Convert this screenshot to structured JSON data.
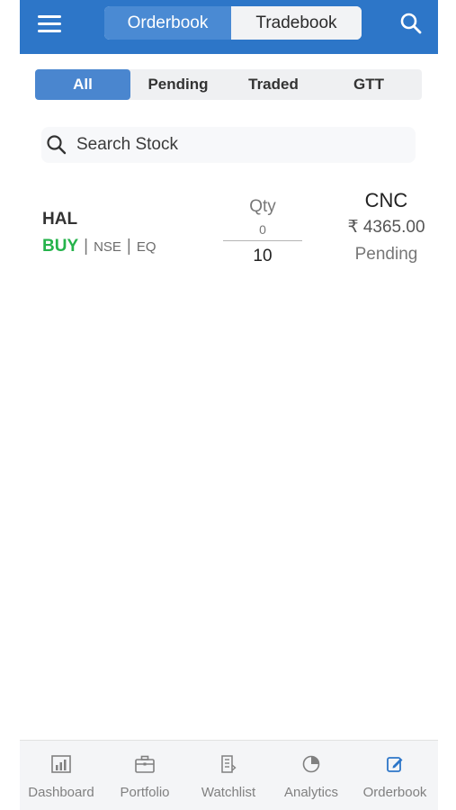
{
  "header": {
    "tabs": [
      {
        "label": "Orderbook",
        "active": true
      },
      {
        "label": "Tradebook",
        "active": false
      }
    ],
    "menu_icon": "hamburger-icon",
    "search_icon": "search-icon",
    "brand_color": "#2d76c8"
  },
  "filters": {
    "tabs": [
      {
        "label": "Pending",
        "active": false
      },
      {
        "label": "All",
        "active": true
      },
      {
        "label": "Traded",
        "active": false
      },
      {
        "label": "GTT",
        "active": false
      }
    ]
  },
  "search": {
    "placeholder": "Search Stock"
  },
  "orders": [
    {
      "symbol": "HAL",
      "side": "BUY",
      "exchange": "NSE",
      "segment": "EQ",
      "qty_label": "Qty",
      "filled_qty": "0",
      "total_qty": "10",
      "product": "CNC",
      "price": "₹ 4365.00",
      "status": "Pending"
    }
  ],
  "bottom_nav": {
    "items": [
      {
        "label": "Dashboard",
        "icon": "chart-icon",
        "active": false
      },
      {
        "label": "Portfolio",
        "icon": "briefcase-icon",
        "active": false
      },
      {
        "label": "Watchlist",
        "icon": "list-icon",
        "active": false
      },
      {
        "label": "Analytics",
        "icon": "pie-chart-icon",
        "active": false
      },
      {
        "label": "Orderbook",
        "icon": "edit-icon",
        "active": true
      }
    ]
  }
}
